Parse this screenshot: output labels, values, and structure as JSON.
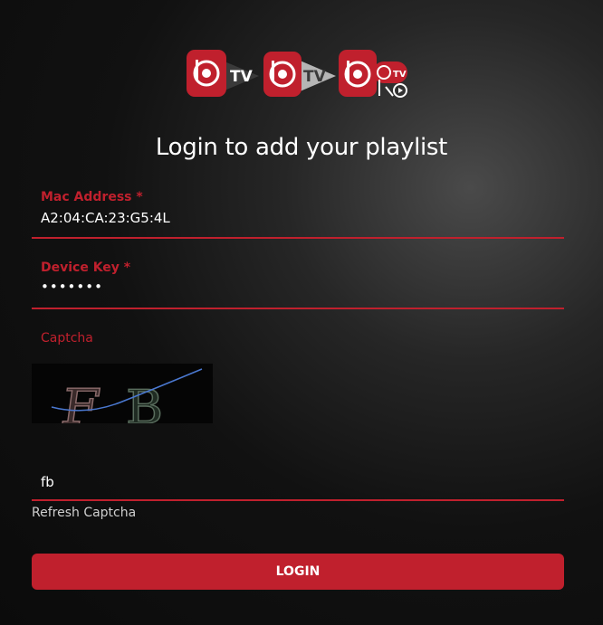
{
  "header": {
    "title": "Login to add your playlist",
    "logos": [
      {
        "name": "ibo-tv-logo",
        "text": "TV"
      },
      {
        "name": "ibo-player-tv-logo",
        "text": "TV"
      },
      {
        "name": "ibo-pro-tv-logo",
        "text": "TV"
      }
    ]
  },
  "form": {
    "mac": {
      "label": "Mac Address *",
      "value": "A2:04:CA:23:G5:4L"
    },
    "device_key": {
      "label": "Device Key *",
      "value": "•••••••"
    },
    "captcha": {
      "label": "Captcha",
      "image_text": "FB",
      "input_value": "fb"
    },
    "refresh_label": "Refresh Captcha",
    "login_label": "LOGIN"
  },
  "colors": {
    "accent": "#c0202d",
    "background": "#111111",
    "text": "#ffffff"
  }
}
